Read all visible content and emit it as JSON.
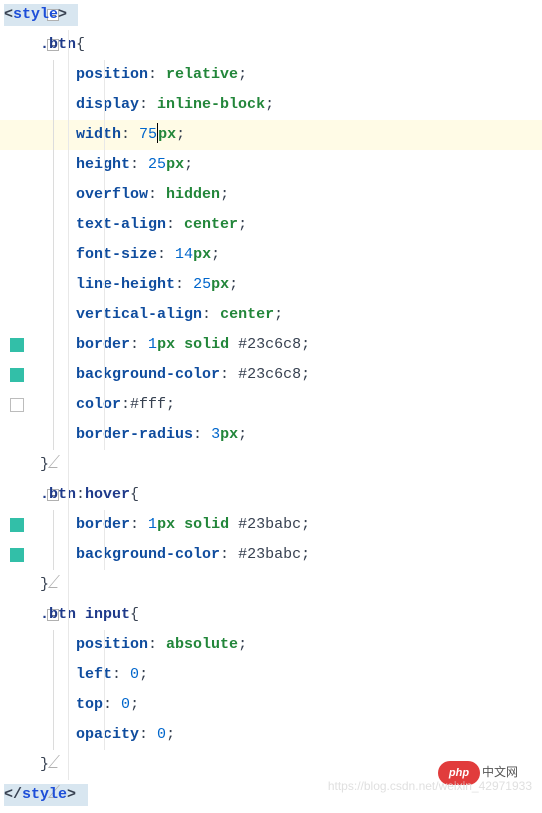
{
  "editor": {
    "highlighted_line_index": 4,
    "cursor": {
      "line": 4,
      "after_text": "75"
    }
  },
  "lines": [
    {
      "indent": 0,
      "type": "open-tag",
      "tag": "style",
      "fold": "minus",
      "guides": []
    },
    {
      "indent": 1,
      "type": "selector",
      "text": ".btn",
      "brace": "{",
      "fold": "minus",
      "guides": [
        1
      ]
    },
    {
      "indent": 2,
      "type": "decl",
      "prop": "position",
      "value": "relative",
      "guides": [
        1,
        2
      ]
    },
    {
      "indent": 2,
      "type": "decl",
      "prop": "display",
      "value": "inline-block",
      "guides": [
        1,
        2
      ]
    },
    {
      "indent": 2,
      "type": "decl",
      "prop": "width",
      "num": "75",
      "unit": "px",
      "hl": true,
      "cursor": true,
      "guides": [
        1,
        2
      ]
    },
    {
      "indent": 2,
      "type": "decl",
      "prop": "height",
      "num": "25",
      "unit": "px",
      "guides": [
        1,
        2
      ]
    },
    {
      "indent": 2,
      "type": "decl",
      "prop": "overflow",
      "value": "hidden",
      "guides": [
        1,
        2
      ]
    },
    {
      "indent": 2,
      "type": "decl",
      "prop": "text-align",
      "value": "center",
      "guides": [
        1,
        2
      ]
    },
    {
      "indent": 2,
      "type": "decl",
      "prop": "font-size",
      "num": "14",
      "unit": "px",
      "guides": [
        1,
        2
      ]
    },
    {
      "indent": 2,
      "type": "decl",
      "prop": "line-height",
      "num": "25",
      "unit": "px",
      "guides": [
        1,
        2
      ]
    },
    {
      "indent": 2,
      "type": "decl",
      "prop": "vertical-align",
      "value": "center",
      "guides": [
        1,
        2
      ]
    },
    {
      "indent": 2,
      "type": "decl",
      "prop": "border",
      "border_num": "1",
      "border_unit": "px",
      "border_style": "solid",
      "hex": "#23c6c8",
      "mark": "fill",
      "guides": [
        1,
        2
      ]
    },
    {
      "indent": 2,
      "type": "decl",
      "prop": "background-color",
      "hex": "#23c6c8",
      "mark": "fill",
      "guides": [
        1,
        2
      ]
    },
    {
      "indent": 2,
      "type": "decl",
      "prop": "color",
      "hex": "#fff",
      "no_space": true,
      "mark": "open",
      "guides": [
        1,
        2
      ]
    },
    {
      "indent": 2,
      "type": "decl",
      "prop": "border-radius",
      "num": "3",
      "unit": "px",
      "guides": [
        1,
        2
      ]
    },
    {
      "indent": 1,
      "type": "brace-close",
      "fold": "end",
      "guides": [
        1
      ]
    },
    {
      "indent": 1,
      "type": "selector",
      "text": ".btn:hover",
      "brace": "{",
      "fold": "minus",
      "guides": [
        1
      ]
    },
    {
      "indent": 2,
      "type": "decl",
      "prop": "border",
      "border_num": "1",
      "border_unit": "px",
      "border_style": "solid",
      "hex": "#23babc",
      "mark": "fill",
      "guides": [
        1,
        2
      ]
    },
    {
      "indent": 2,
      "type": "decl",
      "prop": "background-color",
      "hex": "#23babc",
      "mark": "fill",
      "guides": [
        1,
        2
      ]
    },
    {
      "indent": 1,
      "type": "brace-close",
      "fold": "end",
      "guides": [
        1
      ]
    },
    {
      "indent": 1,
      "type": "selector",
      "text": ".btn input",
      "brace": "{",
      "fold": "minus",
      "guides": [
        1
      ]
    },
    {
      "indent": 2,
      "type": "decl",
      "prop": "position",
      "value": "absolute",
      "guides": [
        1,
        2
      ]
    },
    {
      "indent": 2,
      "type": "decl",
      "prop": "left",
      "num": "0",
      "guides": [
        1,
        2
      ]
    },
    {
      "indent": 2,
      "type": "decl",
      "prop": "top",
      "num": "0",
      "guides": [
        1,
        2
      ]
    },
    {
      "indent": 2,
      "type": "decl",
      "prop": "opacity",
      "num": "0",
      "guides": [
        1,
        2
      ]
    },
    {
      "indent": 1,
      "type": "brace-close",
      "fold": "end",
      "guides": [
        1
      ]
    },
    {
      "indent": 0,
      "type": "close-tag",
      "tag": "style",
      "fold": "end",
      "guides": []
    }
  ],
  "watermark": {
    "url": "https://blog.csdn.net/weixin_42971933",
    "logo_text": "php",
    "logo_cn": "中文网"
  }
}
